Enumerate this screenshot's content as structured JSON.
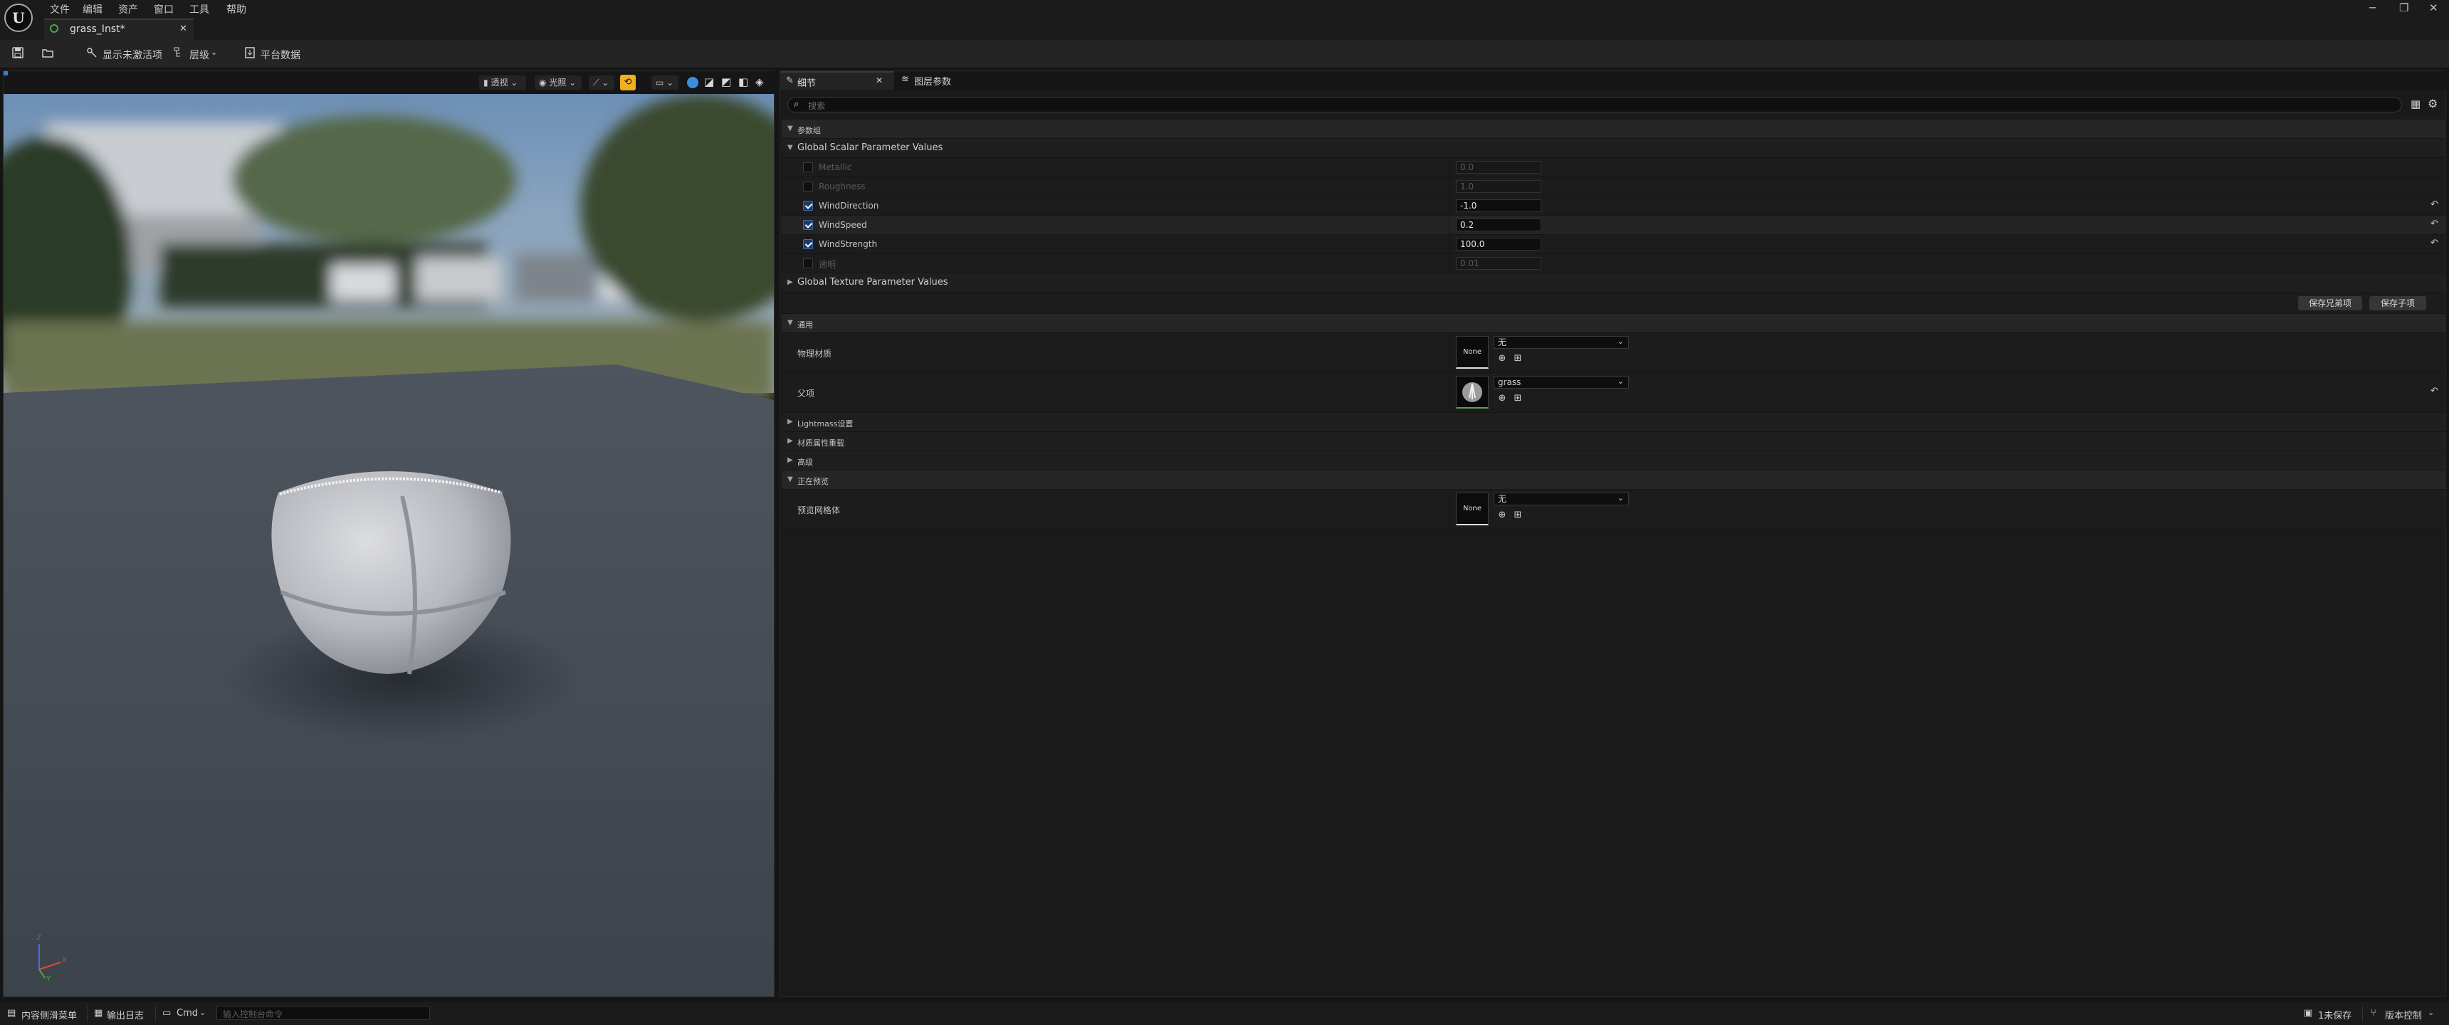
{
  "menubar": {
    "items": [
      "文件",
      "编辑",
      "资产",
      "窗口",
      "工具",
      "帮助"
    ],
    "window_buttons": [
      "─",
      "❐",
      "✕"
    ]
  },
  "document_tab": {
    "title": "grass_Inst*",
    "close": "✕"
  },
  "toolbar": {
    "show_inactive_label": "显示未激活项",
    "hierarchy_label": "层级",
    "platform_stats_label": "平台数据"
  },
  "viewport": {
    "perspective_label": "透视",
    "lit_label": "光照",
    "axis_labels": {
      "z": "Z",
      "x": "X",
      "y": "Y"
    }
  },
  "details_tabs": [
    {
      "label": "细节",
      "close": "✕"
    },
    {
      "label": "图层参数"
    }
  ],
  "search": {
    "placeholder": "搜索"
  },
  "sections": {
    "parameter_groups": "参数组",
    "global_scalar": "Global Scalar Parameter Values",
    "global_texture": "Global Texture Parameter Values",
    "general": "通用",
    "lightmass": "Lightmass设置",
    "material_override": "材质属性重载",
    "advanced": "高级",
    "previewing": "正在预览"
  },
  "scalar_params": [
    {
      "name": "Metallic",
      "value": "0.0",
      "enabled": false
    },
    {
      "name": "Roughness",
      "value": "1.0",
      "enabled": false
    },
    {
      "name": "WindDirection",
      "value": "-1.0",
      "enabled": true
    },
    {
      "name": "WindSpeed",
      "value": "0.2",
      "enabled": true
    },
    {
      "name": "WindStrength",
      "value": "100.0",
      "enabled": true
    },
    {
      "name": "透明",
      "value": "0.01",
      "enabled": false
    }
  ],
  "buttons": {
    "save_sibling": "保存兄弟项",
    "save_child": "保存子项"
  },
  "general": {
    "phys_material_label": "物理材质",
    "phys_material_value": "无",
    "phys_thumb": "None",
    "parent_label": "父项",
    "parent_value": "grass"
  },
  "preview": {
    "mesh_label": "预览网格体",
    "mesh_value": "无",
    "mesh_thumb": "None"
  },
  "statusbar": {
    "content_drawer": "内容侧滑菜单",
    "output_log": "输出日志",
    "cmd": "Cmd",
    "console_placeholder": "输入控制台命令",
    "unsaved": "1未保存",
    "source_control": "版本控制"
  },
  "colors": {
    "accent": "#f0b020",
    "checkbox_on": "#1e3b66",
    "panel": "#1a1a1a"
  }
}
